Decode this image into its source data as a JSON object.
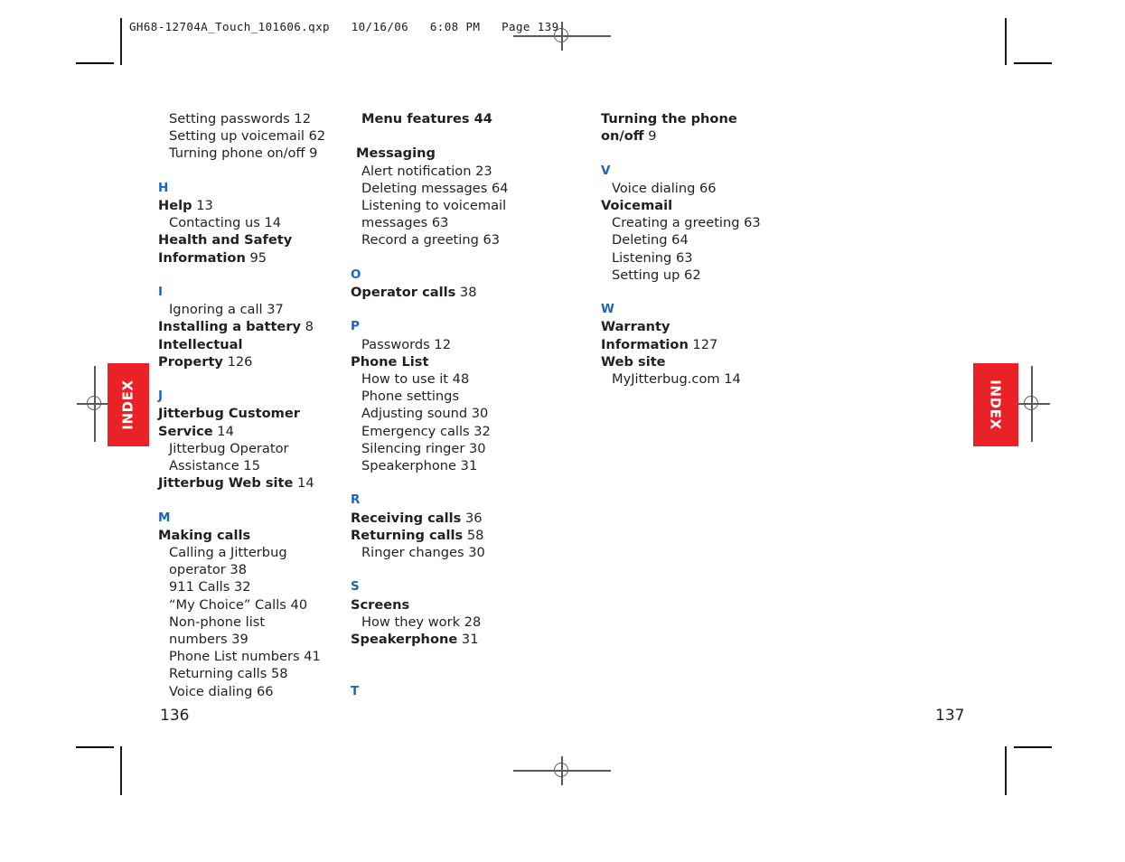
{
  "prepress": {
    "header": "GH68-12704A_Touch_101606.qxp   10/16/06   6:08 PM   Page 139",
    "reg_mark_name": "registration-crosshair"
  },
  "tabs": {
    "left_label": "INDEX",
    "right_label": "INDEX",
    "color": "#ea2227"
  },
  "pages": {
    "left_number": "136",
    "right_number": "137"
  },
  "theme": {
    "letter_color": "#1b66b8",
    "text_color": "#231f20"
  },
  "columns": [
    {
      "id": "column-1",
      "blocks": [
        {
          "type": "sub",
          "text": "Setting passwords 12"
        },
        {
          "type": "sub",
          "text": "Setting up voicemail 62"
        },
        {
          "type": "sub",
          "text": "Turning phone on/off 9"
        },
        {
          "type": "gap"
        },
        {
          "type": "letter",
          "text": "H"
        },
        {
          "type": "entry",
          "text": "Help",
          "page": "13"
        },
        {
          "type": "sub",
          "text": "Contacting us 14"
        },
        {
          "type": "entry",
          "text": "Health and Safety"
        },
        {
          "type": "entry",
          "text": "Information",
          "page": "95"
        },
        {
          "type": "gap"
        },
        {
          "type": "letter",
          "text": "I"
        },
        {
          "type": "sub",
          "text": "Ignoring a call 37"
        },
        {
          "type": "entry",
          "text": "Installing a battery",
          "page": "8"
        },
        {
          "type": "entry",
          "text": "Intellectual"
        },
        {
          "type": "entry",
          "text": "Property",
          "page": "126"
        },
        {
          "type": "gap"
        },
        {
          "type": "letter",
          "text": "J"
        },
        {
          "type": "entry",
          "text": "Jitterbug Customer"
        },
        {
          "type": "entry",
          "text": "Service",
          "page": "14"
        },
        {
          "type": "sub",
          "text": "Jitterbug Operator"
        },
        {
          "type": "sub",
          "text": "Assistance 15"
        },
        {
          "type": "entry",
          "text": "Jitterbug Web site",
          "page": "14"
        },
        {
          "type": "gap"
        },
        {
          "type": "letter",
          "text": "M"
        },
        {
          "type": "entry",
          "text": "Making calls"
        },
        {
          "type": "sub",
          "text": "Calling a Jitterbug"
        },
        {
          "type": "sub",
          "text": "operator 38"
        },
        {
          "type": "sub",
          "text": "911 Calls 32"
        },
        {
          "type": "sub",
          "text": "“My Choice” Calls 40"
        },
        {
          "type": "sub",
          "text": "Non-phone list"
        },
        {
          "type": "sub",
          "text": "numbers 39"
        },
        {
          "type": "sub",
          "text": "Phone List numbers 41"
        },
        {
          "type": "sub",
          "text": "Returning calls 58"
        },
        {
          "type": "sub",
          "text": "Voice dialing 66"
        }
      ]
    },
    {
      "id": "column-2",
      "blocks": [
        {
          "type": "sub-bold",
          "text": "Menu",
          "page": "features 44"
        },
        {
          "type": "gap"
        },
        {
          "type": "entry-indent",
          "text": "Messaging"
        },
        {
          "type": "sub",
          "text": "Alert notification 23"
        },
        {
          "type": "sub",
          "text": "Deleting messages 64"
        },
        {
          "type": "sub",
          "text": "Listening to voicemail"
        },
        {
          "type": "sub",
          "text": "messages 63"
        },
        {
          "type": "sub",
          "text": "Record a greeting 63"
        },
        {
          "type": "gap"
        },
        {
          "type": "letter",
          "text": "O"
        },
        {
          "type": "entry",
          "text": "Operator calls",
          "page": "38"
        },
        {
          "type": "gap"
        },
        {
          "type": "letter",
          "text": "P"
        },
        {
          "type": "sub",
          "text": "Passwords 12"
        },
        {
          "type": "entry",
          "text": "Phone List"
        },
        {
          "type": "sub",
          "text": "How to use it 48"
        },
        {
          "type": "sub",
          "text": "Phone settings"
        },
        {
          "type": "sub",
          "text": "Adjusting sound 30"
        },
        {
          "type": "sub",
          "text": "Emergency calls 32"
        },
        {
          "type": "sub",
          "text": "Silencing ringer 30"
        },
        {
          "type": "sub",
          "text": "Speakerphone 31"
        },
        {
          "type": "gap"
        },
        {
          "type": "letter",
          "text": "R"
        },
        {
          "type": "entry",
          "text": "Receiving calls",
          "page": "36"
        },
        {
          "type": "entry",
          "text": "Returning calls",
          "page": "58"
        },
        {
          "type": "sub",
          "text": "Ringer changes 30"
        },
        {
          "type": "gap"
        },
        {
          "type": "letter",
          "text": "S"
        },
        {
          "type": "entry",
          "text": "Screens"
        },
        {
          "type": "sub",
          "text": "How they work 28"
        },
        {
          "type": "entry",
          "text": "Speakerphone",
          "page": "31"
        },
        {
          "type": "gap"
        },
        {
          "type": "gap"
        },
        {
          "type": "letter",
          "text": "T"
        }
      ]
    },
    {
      "id": "column-3",
      "blocks": [
        {
          "type": "entry",
          "text": "Turning the phone"
        },
        {
          "type": "entry",
          "text": "on/off",
          "page": "9"
        },
        {
          "type": "gap"
        },
        {
          "type": "letter",
          "text": "V"
        },
        {
          "type": "sub",
          "text": "Voice dialing 66"
        },
        {
          "type": "entry",
          "text": "Voicemail"
        },
        {
          "type": "sub",
          "text": "Creating a greeting 63"
        },
        {
          "type": "sub",
          "text": "Deleting 64"
        },
        {
          "type": "sub",
          "text": "Listening 63"
        },
        {
          "type": "sub",
          "text": "Setting up 62"
        },
        {
          "type": "gap"
        },
        {
          "type": "letter",
          "text": "W"
        },
        {
          "type": "entry",
          "text": "Warranty"
        },
        {
          "type": "entry",
          "text": "Information",
          "page": "127"
        },
        {
          "type": "entry",
          "text": "Web site"
        },
        {
          "type": "sub",
          "text": "MyJitterbug.com 14"
        }
      ]
    }
  ]
}
